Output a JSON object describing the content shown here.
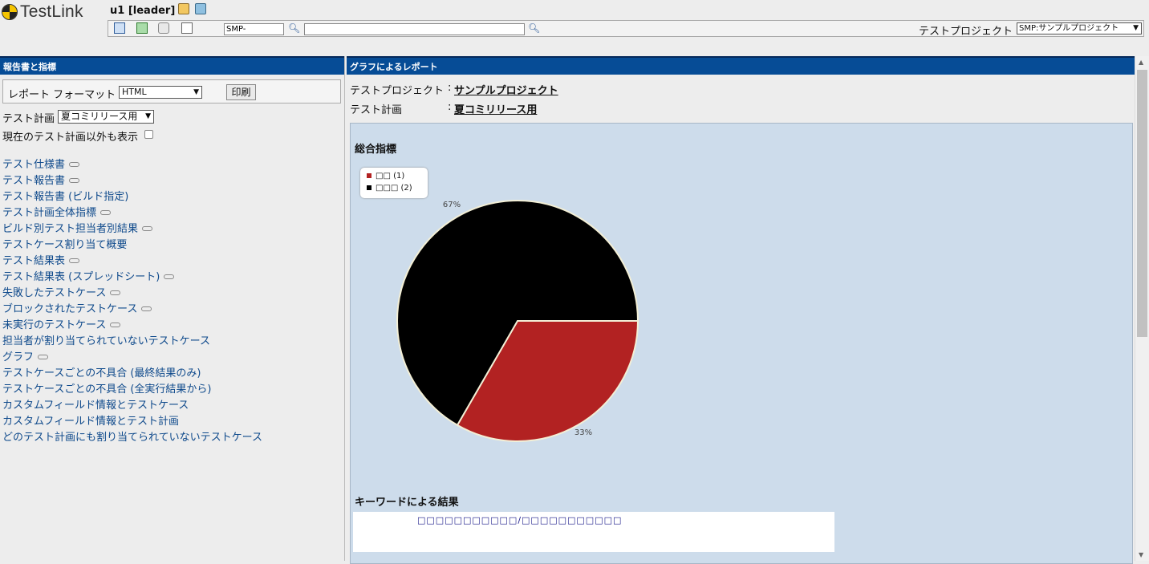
{
  "header": {
    "logo_text": "TestLink",
    "user": "u1 [leader]",
    "testcase_id_prefix": "SMP-",
    "project_label": "テストプロジェクト",
    "project_selected": "SMP:サンプルプロジェクト",
    "search_icon": "magnifier-icon"
  },
  "left": {
    "title": "報告書と指標",
    "format_label": "レポート フォーマット",
    "format_selected": "HTML",
    "print_label": "印刷",
    "plan_label": "テスト計画",
    "plan_selected": "夏コミリリース用",
    "show_all_label": "現在のテスト計画以外も表示",
    "links": [
      {
        "label": "テスト仕様書",
        "has_link_icon": true
      },
      {
        "label": "テスト報告書",
        "has_link_icon": true
      },
      {
        "label": "テスト報告書 (ビルド指定)",
        "has_link_icon": false
      },
      {
        "label": "テスト計画全体指標",
        "has_link_icon": true
      },
      {
        "label": "ビルド別テスト担当者別結果",
        "has_link_icon": true
      },
      {
        "label": "テストケース割り当て概要",
        "has_link_icon": false
      },
      {
        "label": "テスト結果表",
        "has_link_icon": true
      },
      {
        "label": "テスト結果表 (スプレッドシート)",
        "has_link_icon": true
      },
      {
        "label": "失敗したテストケース",
        "has_link_icon": true
      },
      {
        "label": "ブロックされたテストケース",
        "has_link_icon": true
      },
      {
        "label": "未実行のテストケース",
        "has_link_icon": true
      },
      {
        "label": "担当者が割り当てられていないテストケース",
        "has_link_icon": false
      },
      {
        "label": "グラフ",
        "has_link_icon": true
      },
      {
        "label": "テストケースごとの不具合 (最終結果のみ)",
        "has_link_icon": false
      },
      {
        "label": "テストケースごとの不具合 (全実行結果から)",
        "has_link_icon": false
      },
      {
        "label": "カスタムフィールド情報とテストケース",
        "has_link_icon": false
      },
      {
        "label": "カスタムフィールド情報とテスト計画",
        "has_link_icon": false
      },
      {
        "label": "どのテスト計画にも割り当てられていないテストケース",
        "has_link_icon": false
      }
    ]
  },
  "right": {
    "title": "グラフによるレポート",
    "project_label": "テストプロジェクト",
    "project_value": "サンプルプロジェクト",
    "plan_label": "テスト計画",
    "plan_value": "夏コミリリース用",
    "overall_title": "総合指標",
    "keyword_title": "キーワードによる結果",
    "keyword_header": "□□□□□□□□□□□/□□□□□□□□□□□"
  },
  "chart_data": {
    "type": "pie",
    "title": "総合指標",
    "legend_position": "top-left",
    "slices": [
      {
        "label": "□□ (1)",
        "value": 1,
        "percent_label": "33%",
        "color": "#b22222"
      },
      {
        "label": "□□□ (2)",
        "value": 2,
        "percent_label": "67%",
        "color": "#000000"
      }
    ]
  },
  "colors": {
    "frame_title_bg": "#064c96",
    "panel_bg": "#cddceb",
    "link": "#0f4a8c"
  }
}
